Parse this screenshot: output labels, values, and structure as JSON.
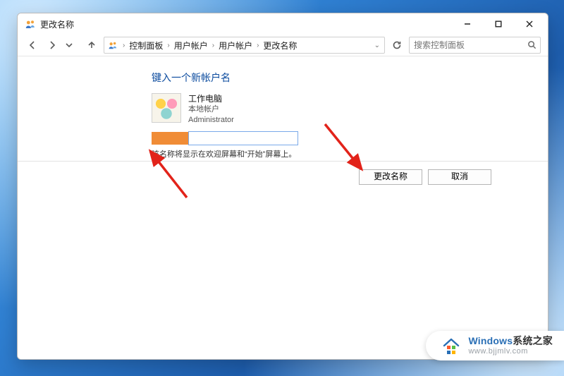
{
  "window": {
    "title": "更改名称"
  },
  "breadcrumb": {
    "items": [
      "控制面板",
      "用户帐户",
      "用户帐户",
      "更改名称"
    ]
  },
  "search": {
    "placeholder": "搜索控制面板"
  },
  "page": {
    "heading": "键入一个新帐户名",
    "account": {
      "display_name": "工作电脑",
      "type": "本地帐户",
      "role": "Administrator"
    },
    "name_input": {
      "value": ""
    },
    "hint": "该名称将显示在欢迎屏幕和“开始”屏幕上。",
    "actions": {
      "primary": "更改名称",
      "cancel": "取消"
    }
  },
  "watermark": {
    "brand": "Windows",
    "brand_suffix": "系统之家",
    "url": "www.bjjmlv.com"
  },
  "annotation": {
    "arrow_color": "#e2231a"
  }
}
